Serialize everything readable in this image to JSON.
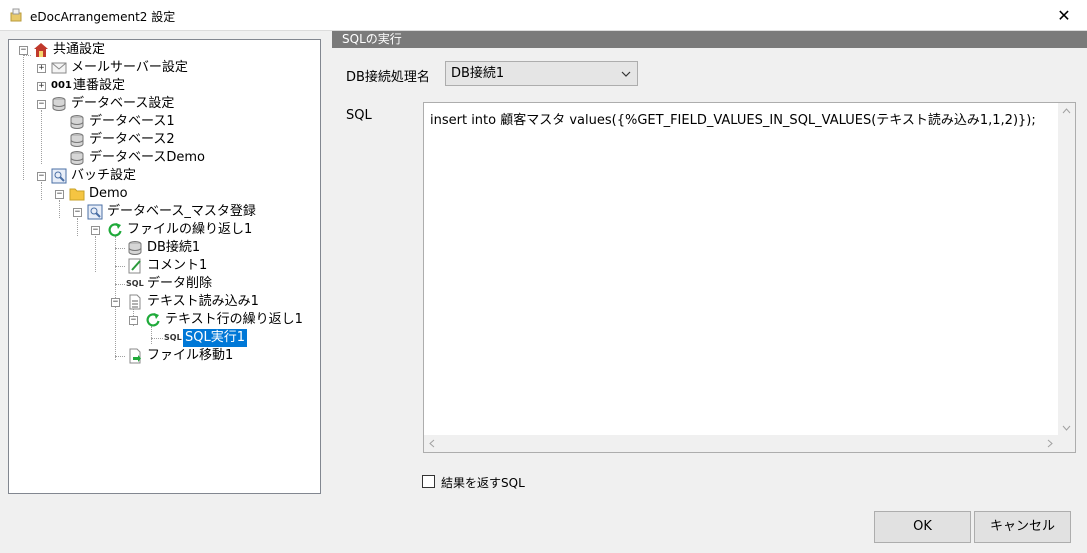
{
  "window": {
    "title": "eDocArrangement2 設定",
    "close_glyph": "✕"
  },
  "tree": {
    "items": [
      {
        "label": "共通設定",
        "icon": "house-icon",
        "expander": "−"
      },
      {
        "label": "メールサーバー設定",
        "icon": "mail-icon",
        "expander": "+"
      },
      {
        "label": "連番設定",
        "icon": "serial-number-icon",
        "icon_text": "001",
        "expander": "+"
      },
      {
        "label": "データベース設定",
        "icon": "database-icon",
        "expander": "−"
      },
      {
        "label": "データベース1",
        "icon": "database-icon"
      },
      {
        "label": "データベース2",
        "icon": "database-icon"
      },
      {
        "label": "データベースDemo",
        "icon": "database-icon"
      },
      {
        "label": "バッチ設定",
        "icon": "batch-settings-icon",
        "expander": "−"
      },
      {
        "label": "Demo",
        "icon": "folder-icon",
        "expander": "−"
      },
      {
        "label": "データベース_マスタ登録",
        "icon": "batch-settings-icon",
        "expander": "−"
      },
      {
        "label": "ファイルの繰り返し1",
        "icon": "loop-icon",
        "expander": "−"
      },
      {
        "label": "DB接続1",
        "icon": "database-icon"
      },
      {
        "label": "コメント1",
        "icon": "comment-icon"
      },
      {
        "label": "データ削除",
        "icon": "sql-icon",
        "icon_text": "SQL"
      },
      {
        "label": "テキスト読み込み1",
        "icon": "text-file-icon",
        "expander": "−"
      },
      {
        "label": "テキスト行の繰り返し1",
        "icon": "loop-icon",
        "expander": "−"
      },
      {
        "label": "SQL実行1",
        "icon": "sql-icon",
        "icon_text": "SQL",
        "selected": true
      },
      {
        "label": "ファイル移動1",
        "icon": "file-move-icon"
      }
    ]
  },
  "panel": {
    "header": "SQLの実行",
    "db_label": "DB接続処理名",
    "db_value": "DB接続1",
    "sql_label": "SQL",
    "sql_text": "insert into 顧客マスタ values({%GET_FIELD_VALUES_IN_SQL_VALUES(テキスト読み込み1,1,2)});",
    "return_sql_label": "結果を返すSQL"
  },
  "buttons": {
    "ok": "OK",
    "cancel": "キャンセル"
  },
  "colors": {
    "selection": "#0078d7",
    "header_bg": "#7a7a7a",
    "loop_green": "#1faa3a"
  }
}
